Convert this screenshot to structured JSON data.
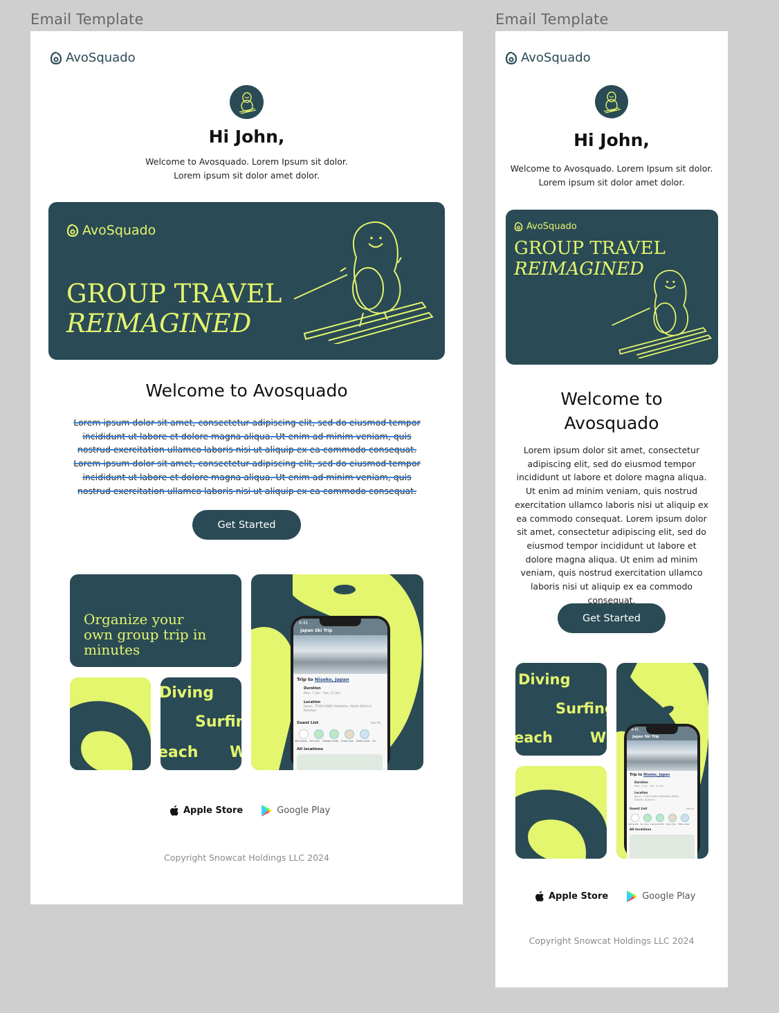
{
  "frame_label": "Email Template",
  "brand": "AvoSquado",
  "greeting": "Hi John,",
  "intro_line1": "Welcome to Avosquado. Lorem Ipsum sit dolor.",
  "intro_line2": "Lorem ipsum sit dolor amet dolor.",
  "hero": {
    "line1": "GROUP TRAVEL",
    "line2": "REIMAGINED"
  },
  "section_title": "Welcome to Avosquado",
  "body": "Lorem ipsum dolor sit amet, consectetur adipiscing elit, sed do eiusmod tempor incididunt ut labore et dolore magna aliqua. Ut enim ad minim veniam, quis nostrud exercitation ullamco laboris nisi ut aliquip ex ea commodo consequat. Lorem ipsum dolor sit amet, consectetur adipiscing elit, sed do eiusmod tempor incididunt ut labore et dolore magna aliqua. Ut enim ad minim veniam, quis nostrud exercitation ullamco laboris nisi ut aliquip ex ea commodo consequat.",
  "cta": "Get Started",
  "tile_text": "Organize your own group trip in minutes",
  "scribble": {
    "w1": "Diving",
    "w2": "Surfing",
    "w3": "each",
    "w4": "W"
  },
  "phone": {
    "time": "9:41",
    "trip_name": "Japan Ski Trip",
    "trip_to": "Trip to",
    "destination": "Niseko, Japan",
    "duration_label": "Duration",
    "duration": "Mon, 7 Jan - Tue, 21 Jan",
    "location_label": "Location",
    "location": "Japan, 〒044-0080 Hokkaido, Abuta District, Kutchan",
    "guest_list": "Guest List",
    "see_all": "See All",
    "add_guest": "Add Guest",
    "guests": [
      "Ann Doe",
      "George Smith",
      "Rubin Doe",
      "Eddie Lobel",
      "An"
    ],
    "all_locations": "All locations"
  },
  "stores": {
    "apple": "Apple Store",
    "google": "Google Play"
  },
  "copyright": "Copyright Snowcat Holdings LLC 2024",
  "colors": {
    "brand_dark": "#2a4a55",
    "brand_lime": "#e4f56e",
    "canvas": "#cfcfcf",
    "highlight": "#3b82d6"
  }
}
